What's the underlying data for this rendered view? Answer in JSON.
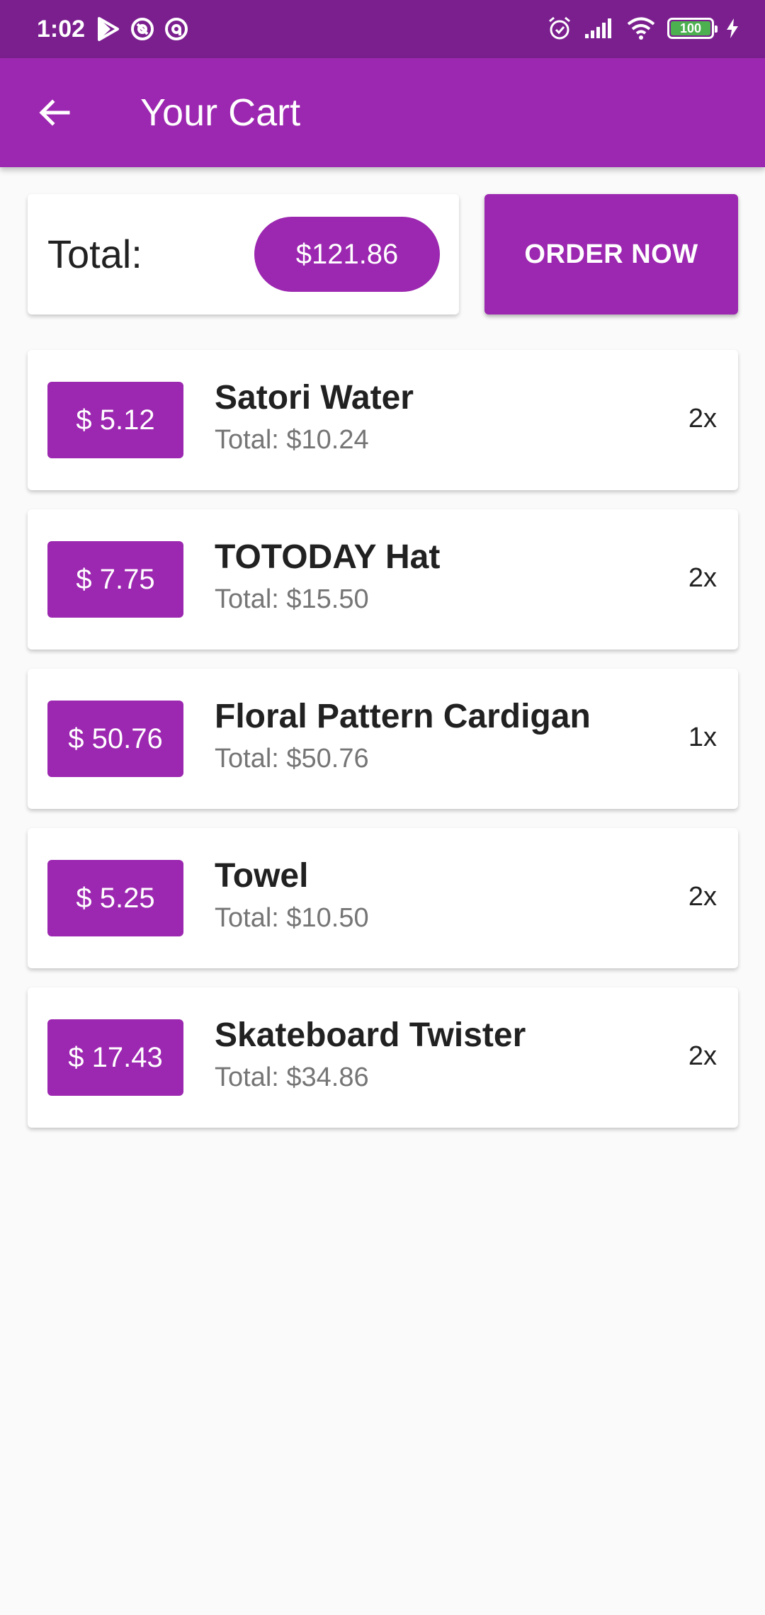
{
  "status_bar": {
    "time": "1:02",
    "battery": "100",
    "left_icons": [
      "play-store-icon",
      "at-icon",
      "at-icon"
    ],
    "right_icons": [
      "alarm-icon",
      "signal-icon",
      "wifi-icon",
      "battery-icon",
      "charging-icon"
    ]
  },
  "app_bar": {
    "title": "Your Cart",
    "back_icon": "arrow-back-icon"
  },
  "summary": {
    "total_label": "Total:",
    "total_value": "$121.86",
    "order_button": "ORDER NOW"
  },
  "items": [
    {
      "price": "$ 5.12",
      "name": "Satori Water",
      "total": "Total: $10.24",
      "qty": "2x"
    },
    {
      "price": "$ 7.75",
      "name": "TOTODAY Hat",
      "total": "Total: $15.50",
      "qty": "2x"
    },
    {
      "price": "$ 50.76",
      "name": "Floral Pattern Cardigan",
      "total": "Total: $50.76",
      "qty": "1x"
    },
    {
      "price": "$ 5.25",
      "name": "Towel",
      "total": "Total: $10.50",
      "qty": "2x"
    },
    {
      "price": "$ 17.43",
      "name": "Skateboard Twister",
      "total": "Total: $34.86",
      "qty": "2x"
    }
  ],
  "colors": {
    "status_bar": "#7b1f8f",
    "primary": "#9c27b0",
    "background": "#fafafa",
    "card": "#ffffff",
    "text_primary": "#212121",
    "text_secondary": "#757575"
  }
}
